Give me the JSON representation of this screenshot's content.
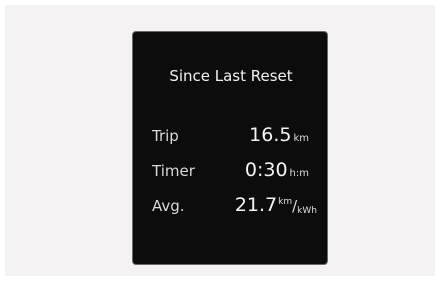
{
  "screen": {
    "title": "Since Last Reset",
    "trip": {
      "label": "Trip",
      "value": "16.5",
      "unit": "km"
    },
    "timer": {
      "label": "Timer",
      "value": "0:30",
      "unit": "h:m"
    },
    "avg": {
      "label": "Avg.",
      "value": "21.7",
      "unit_top": "km",
      "unit_slash": "/",
      "unit_bottom": "kWh"
    }
  }
}
